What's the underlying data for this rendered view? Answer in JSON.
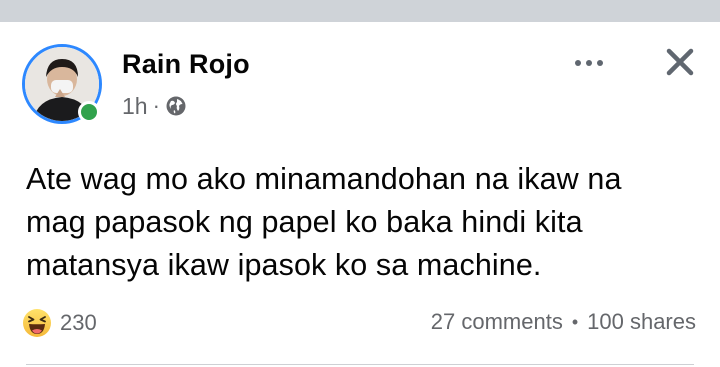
{
  "post": {
    "author": "Rain Rojo",
    "time": "1h",
    "separator": "·",
    "privacy_icon": "globe-icon",
    "text": "Ate wag mo ako minamandohan na ikaw na mag papasok ng papel ko baka hindi kita matansya ikaw ipasok ko sa machine.",
    "online": true
  },
  "actions": {
    "more_icon": "more-options-icon",
    "close_icon": "close-icon"
  },
  "engagement": {
    "reaction_icon": "haha-reaction-icon",
    "reaction_count": "230",
    "comments": "27 comments",
    "bullet": "•",
    "shares": "100 shares"
  },
  "colors": {
    "author_text": "#050505",
    "secondary_text": "#65676b",
    "online_green": "#31a24c",
    "avatar_ring": "#2d88ff",
    "top_strip": "#cfd3d8"
  }
}
